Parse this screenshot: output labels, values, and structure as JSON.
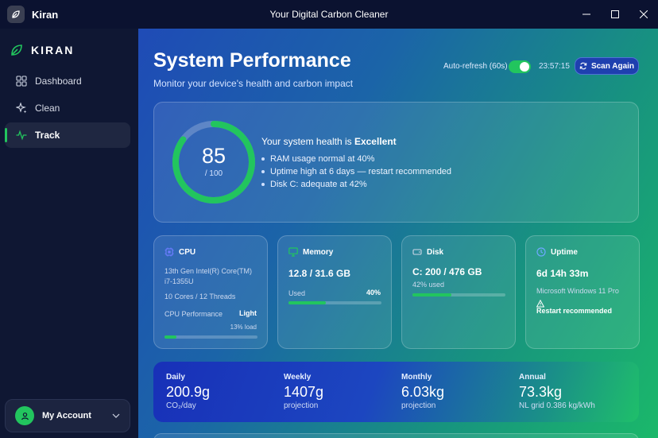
{
  "window": {
    "app_name": "Kiran",
    "title": "Your Digital Carbon Cleaner"
  },
  "sidebar": {
    "brand": "KIRAN",
    "items": [
      {
        "label": "Dashboard",
        "icon": "grid-icon"
      },
      {
        "label": "Clean",
        "icon": "sparkle-icon"
      },
      {
        "label": "Track",
        "icon": "pulse-icon",
        "active": true
      }
    ],
    "account_label": "My Account"
  },
  "header": {
    "title": "System Performance",
    "subtitle": "Monitor your device's health and carbon impact",
    "auto_refresh_label": "Auto-refresh (60s)",
    "auto_refresh_on": true,
    "clock": "23:57:15",
    "scan_label": "Scan Again"
  },
  "health": {
    "score": "85",
    "score_max": "/ 100",
    "score_fraction": 0.85,
    "headline_prefix": "Your system health is ",
    "headline_status": "Excellent",
    "bullets": [
      "RAM usage normal at 40%",
      "Uptime high at 6 days — restart recommended",
      "Disk C: adequate at 42%"
    ]
  },
  "cards": {
    "cpu": {
      "title": "CPU",
      "model": "13th Gen Intel(R) Core(TM) i7-1355U",
      "cores": "10 Cores / 12 Threads",
      "perf_label": "CPU Performance",
      "perf_value": "Light",
      "load_text": "13% load",
      "load_fraction": 0.13
    },
    "memory": {
      "title": "Memory",
      "value": "12.8 / 31.6 GB",
      "used_label": "Used",
      "used_percent": "40%",
      "used_fraction": 0.4
    },
    "disk": {
      "title": "Disk",
      "value": "C: 200 / 476 GB",
      "used_text": "42% used",
      "used_fraction": 0.42
    },
    "uptime": {
      "title": "Uptime",
      "value": "6d 14h 33m",
      "os": "Microsoft Windows 11 Pro",
      "warning": "Restart recommended"
    }
  },
  "impact": [
    {
      "label": "Daily",
      "value": "200.9g",
      "sub": "CO₂/day"
    },
    {
      "label": "Weekly",
      "value": "1407g",
      "sub": "projection"
    },
    {
      "label": "Monthly",
      "value": "6.03kg",
      "sub": "projection"
    },
    {
      "label": "Annual",
      "value": "73.3kg",
      "sub": "NL grid 0.386 kg/kWh"
    }
  ],
  "colors": {
    "accent_green": "#22c55e",
    "cpu_icon": "#6b7cff",
    "memory_icon": "#22c55e",
    "disk_icon": "#cfd8e8",
    "uptime_icon": "#6ea8ff"
  }
}
